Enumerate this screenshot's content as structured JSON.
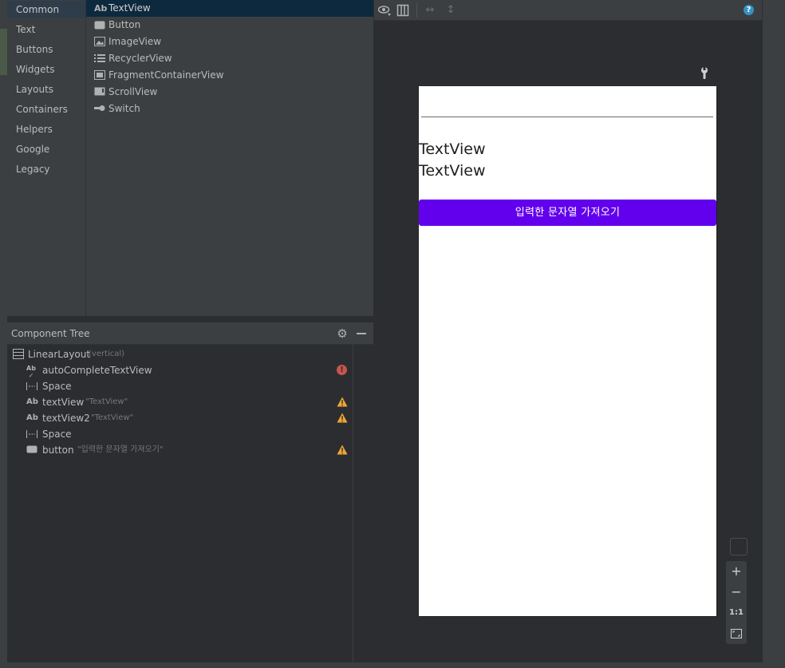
{
  "palette": {
    "categories": [
      {
        "label": "Common",
        "selected": true
      },
      {
        "label": "Text"
      },
      {
        "label": "Buttons"
      },
      {
        "label": "Widgets"
      },
      {
        "label": "Layouts"
      },
      {
        "label": "Containers"
      },
      {
        "label": "Helpers"
      },
      {
        "label": "Google"
      },
      {
        "label": "Legacy"
      }
    ],
    "widgets": [
      {
        "label": "TextView",
        "icon": "text-icon",
        "glyph": "Ab",
        "selected": true
      },
      {
        "label": "Button",
        "icon": "button-icon",
        "glyph": ""
      },
      {
        "label": "ImageView",
        "icon": "image-icon",
        "glyph": ""
      },
      {
        "label": "RecyclerView",
        "icon": "list-icon",
        "glyph": ""
      },
      {
        "label": "FragmentContainerView",
        "icon": "fragment-icon",
        "glyph": ""
      },
      {
        "label": "ScrollView",
        "icon": "scroll-icon",
        "glyph": ""
      },
      {
        "label": "Switch",
        "icon": "switch-icon",
        "glyph": ""
      }
    ]
  },
  "component_tree": {
    "title": "Component Tree",
    "rows": [
      {
        "name": "LinearLayout",
        "sub": "(vertical)",
        "icon": "linear-layout-icon",
        "status": ""
      },
      {
        "name": "autoCompleteTextView",
        "sub": "",
        "icon": "autocomplete-icon",
        "status": "error"
      },
      {
        "name": "Space",
        "sub": "",
        "icon": "space-icon",
        "status": ""
      },
      {
        "name": "textView",
        "sub": "\"TextView\"",
        "icon": "text-icon",
        "status": "warning"
      },
      {
        "name": "textView2",
        "sub": "\"TextView\"",
        "icon": "text-icon",
        "status": "warning"
      },
      {
        "name": "Space",
        "sub": "",
        "icon": "space-icon",
        "status": ""
      },
      {
        "name": "button",
        "sub": "\"입력한 문자열 가져오기\"",
        "icon": "button-icon",
        "status": "warning"
      }
    ],
    "error_glyph": "!"
  },
  "design": {
    "help_glyph": "?",
    "zoom": {
      "plus": "+",
      "minus": "−",
      "one_to_one": "1:1"
    },
    "preview": {
      "textview1": "TextView",
      "textview2": "TextView",
      "button_label": "입력한 문자열 가져오기",
      "button_color": "#6200ee"
    }
  }
}
